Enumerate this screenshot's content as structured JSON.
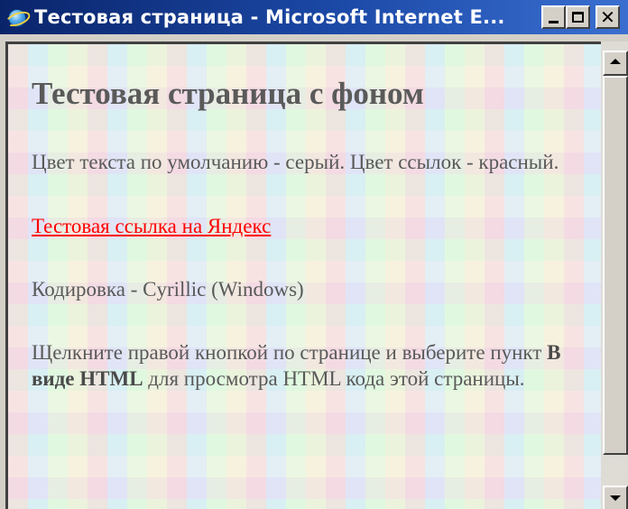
{
  "window": {
    "title": "Тестовая страница - Microsoft Internet E..."
  },
  "page": {
    "heading": "Тестовая страница с фоном",
    "paragraph1": "Цвет текста по умолчанию - серый. Цвет ссылок - красный.",
    "link_text": "Тестовая ссылка на Яндекс",
    "encoding_text": "Кодировка - Cyrillic (Windows)",
    "instruction_before": "Щелкните правой кнопкой по странице и выберите пункт ",
    "instruction_bold": "В виде HTML",
    "instruction_after": " для просмотра HTML кода этой страницы."
  },
  "colors": {
    "text": "#595959",
    "link": "#ff0000",
    "titlebar_start": "#0a246a",
    "titlebar_end": "#3a6fd0",
    "chrome": "#d4d0c8"
  },
  "icons": {
    "app": "internet-explorer-icon",
    "minimize": "minimize-icon",
    "maximize": "maximize-icon",
    "close": "close-icon",
    "scroll_up": "arrow-up-icon",
    "scroll_down": "arrow-down-icon"
  }
}
